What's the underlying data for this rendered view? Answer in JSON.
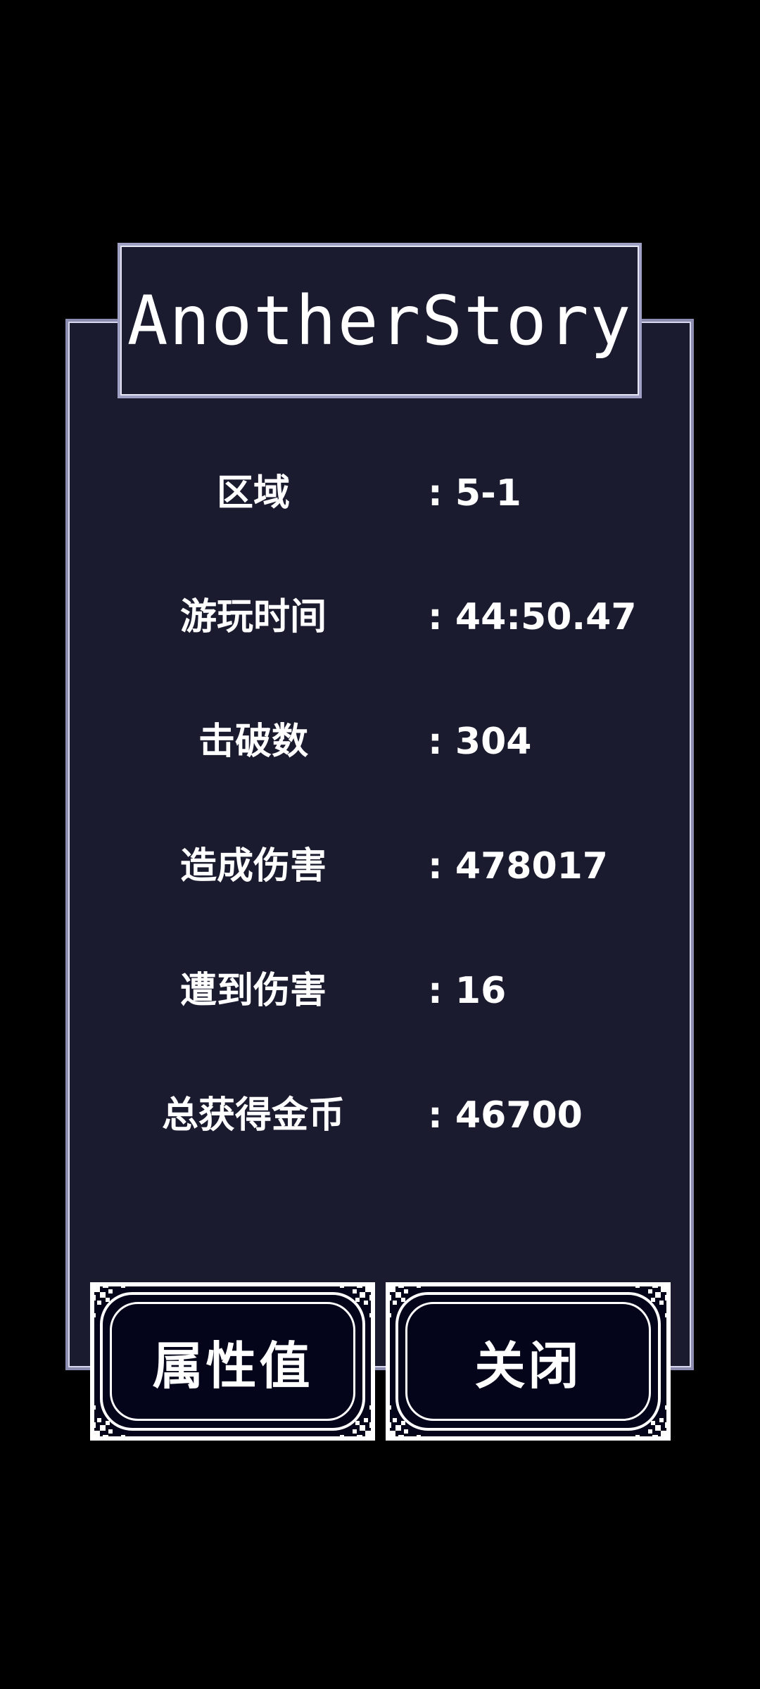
{
  "title": "AnotherStory",
  "stats": [
    {
      "label": "区域",
      "value": ": 5-1"
    },
    {
      "label": "游玩时间",
      "value": ": 44:50.47"
    },
    {
      "label": "击破数",
      "value": ": 304"
    },
    {
      "label": "造成伤害",
      "value": ": 478017"
    },
    {
      "label": "遭到伤害",
      "value": ": 16"
    },
    {
      "label": "总获得金币",
      "value": ": 46700"
    }
  ],
  "buttons": {
    "attributes_label": "属性值",
    "close_label": "关闭"
  },
  "colors": {
    "background": "#000000",
    "panel": "#1b1b30",
    "border": "#a0a0c4",
    "button_fill": "#04041a",
    "text": "#ffffff"
  }
}
